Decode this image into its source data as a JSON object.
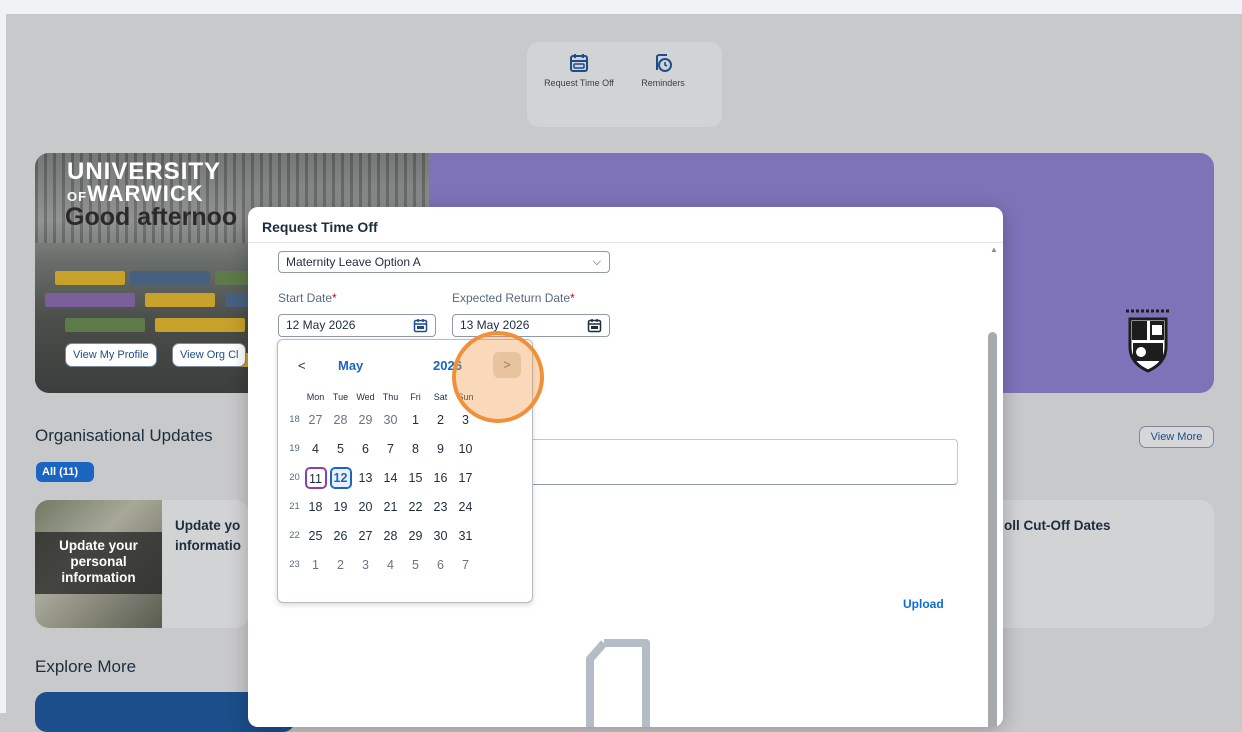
{
  "shortcuts": [
    {
      "label": "Request Time Off",
      "icon": "calendar-icon"
    },
    {
      "label": "Reminders",
      "icon": "reminder-clock-icon"
    }
  ],
  "banner": {
    "logo_line1": "UNIVERSITY",
    "logo_of": "OF",
    "logo_line2": "WARWICK",
    "greeting": "Good afternoo",
    "buttons": [
      "View My Profile",
      "View Org Cl"
    ]
  },
  "org_updates": {
    "title": "Organisational Updates",
    "view_more": "View More",
    "filter_chip": "All (11)",
    "card1": {
      "image_text": "Update your personal information",
      "title_line1": "Update yo",
      "title_line2": "informatio"
    },
    "card2": {
      "title": "oll Cut-Off Dates"
    }
  },
  "explore": {
    "title": "Explore More"
  },
  "dialog": {
    "title": "Request Time Off",
    "leave_type": "Maternity Leave Option A",
    "start_label": "Start Date",
    "start_value": "12 May 2026",
    "return_label": "Expected Return Date",
    "return_value": "13 May 2026",
    "required_mark": "*",
    "upload": "Upload"
  },
  "calendar": {
    "prev": "<",
    "next": ">",
    "month": "May",
    "year": "2026",
    "weekdays": [
      "Mon",
      "Tue",
      "Wed",
      "Thu",
      "Fri",
      "Sat",
      "Sun"
    ],
    "weeks": [
      {
        "wk": "18",
        "days": [
          "27",
          "28",
          "29",
          "30",
          "1",
          "2",
          "3"
        ]
      },
      {
        "wk": "19",
        "days": [
          "4",
          "5",
          "6",
          "7",
          "8",
          "9",
          "10"
        ]
      },
      {
        "wk": "20",
        "days": [
          "11",
          "12",
          "13",
          "14",
          "15",
          "16",
          "17"
        ]
      },
      {
        "wk": "21",
        "days": [
          "18",
          "19",
          "20",
          "21",
          "22",
          "23",
          "24"
        ]
      },
      {
        "wk": "22",
        "days": [
          "25",
          "26",
          "27",
          "28",
          "29",
          "30",
          "31"
        ]
      },
      {
        "wk": "23",
        "days": [
          "1",
          "2",
          "3",
          "4",
          "5",
          "6",
          "7"
        ]
      }
    ],
    "today": "11",
    "selected": "12"
  },
  "colors": {
    "accent": "#1b65c2",
    "banner": "#7e73b9",
    "highlight": "#f0913a",
    "today_border": "#8a3fb0"
  }
}
